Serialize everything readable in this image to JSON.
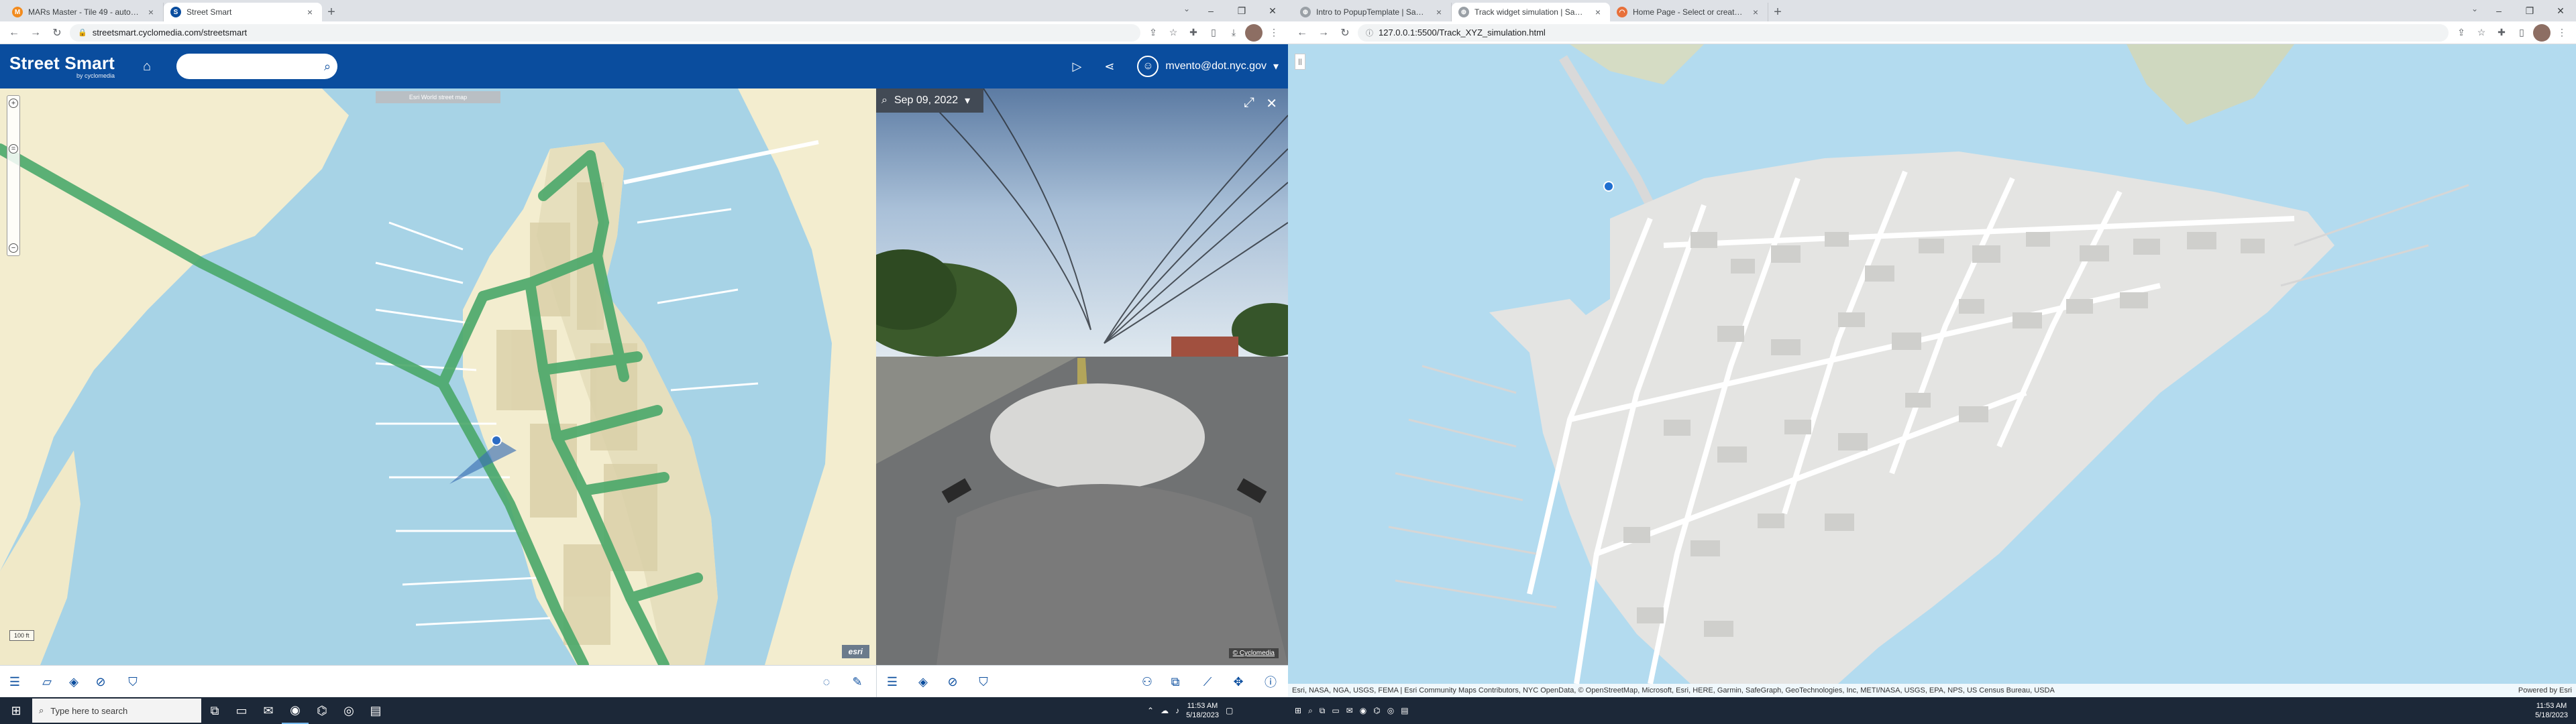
{
  "left_window": {
    "tabs": [
      {
        "title": "MARs Master - Tile 49 - automo",
        "favicon_color": "#f28b1e",
        "favicon_glyph": "M"
      },
      {
        "title": "Street Smart",
        "favicon_color": "#0a4d9e",
        "favicon_glyph": "S"
      }
    ],
    "active_tab": 1,
    "new_tab": "+",
    "url": "streetsmart.cyclomedia.com/streetsmart"
  },
  "streetsmart": {
    "logo": "Street Smart",
    "logo_sub": "by cyclomedia",
    "search_placeholder": "",
    "user": "mvento@dot.nyc.gov",
    "map_caption": "Esri World street map",
    "esri_logo": "esri",
    "scale_label": "100 ft",
    "pano_date": "Sep 09, 2022",
    "pano_copyright": "© Cyclomedia"
  },
  "right_window": {
    "tabs": [
      {
        "title": "Intro to PopupTemplate | Sampl",
        "favicon_glyph": "⊕"
      },
      {
        "title": "Track widget simulation | Sampl",
        "favicon_glyph": "⊕"
      },
      {
        "title": "Home Page - Select or create a",
        "favicon_glyph": "◠"
      }
    ],
    "active_tab": 1,
    "new_tab": "+",
    "url": "127.0.0.1:5500/Track_XYZ_simulation.html",
    "attribution": "Esri, NASA, NGA, USGS, FEMA | Esri Community Maps Contributors, NYC OpenData, © OpenStreetMap, Microsoft, Esri, HERE, Garmin, SafeGraph, GeoTechnologies, Inc, METI/NASA, USGS, EPA, NPS, US Census Bureau, USDA",
    "powered_by": "Powered by Esri",
    "toggle": "||"
  },
  "taskbar": {
    "search_placeholder": "Type here to search",
    "clock_left": {
      "time": "11:53 AM",
      "date": "5/18/2023"
    },
    "clock_right": {
      "time": "11:53 AM",
      "date": "5/18/2023"
    }
  },
  "colors": {
    "streetsmart_blue": "#0a4d9e",
    "water": "#a7d3e6",
    "land": "#f3edcf",
    "road_highlight": "#4aa86a"
  }
}
